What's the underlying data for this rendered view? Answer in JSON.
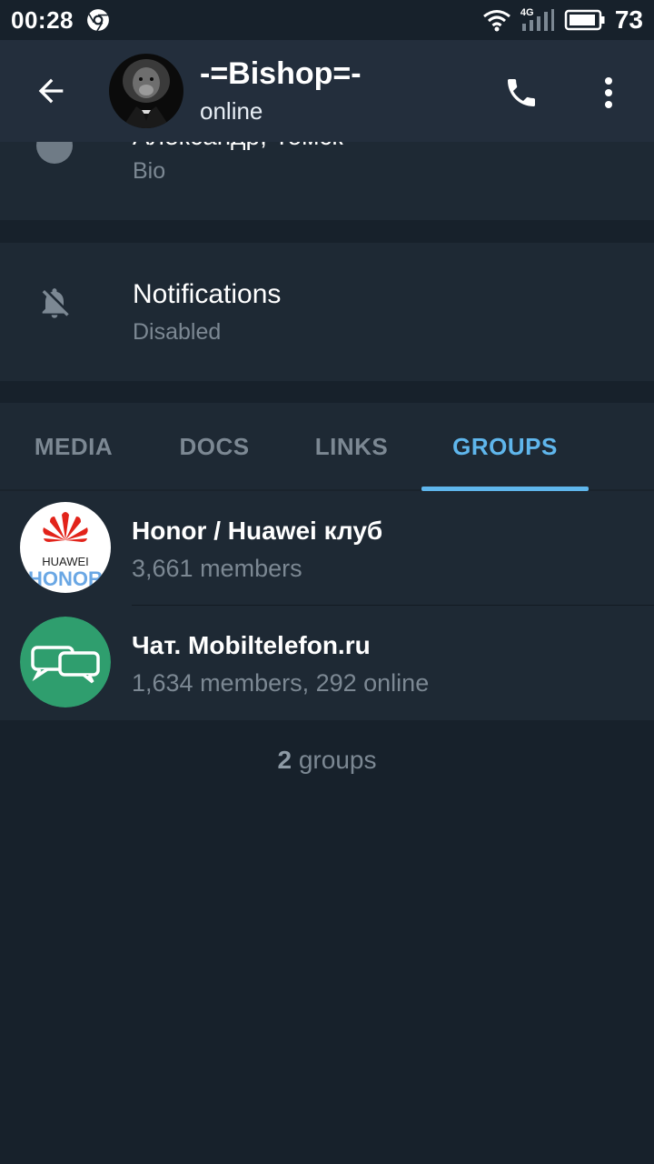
{
  "status_bar": {
    "time": "00:28",
    "network": "4G",
    "battery": "73"
  },
  "header": {
    "title": "-=Bishop=-",
    "status": "online"
  },
  "bio": {
    "value": "Александр, Томск",
    "label": "Bio"
  },
  "notifications": {
    "title": "Notifications",
    "value": "Disabled"
  },
  "tabs": [
    {
      "label": "MEDIA",
      "active": false
    },
    {
      "label": "DOCS",
      "active": false
    },
    {
      "label": "LINKS",
      "active": false
    },
    {
      "label": "GROUPS",
      "active": true
    }
  ],
  "groups": [
    {
      "name": "Honor / Huawei клуб",
      "meta": "3,661 members",
      "avatar": {
        "brand_top": "HUAWEI",
        "brand_bottom": "HONOR"
      }
    },
    {
      "name": "Чат. Mobiltelefon.ru",
      "meta": "1,634 members, 292 online"
    }
  ],
  "footer": {
    "count": "2",
    "label": "groups"
  },
  "colors": {
    "accent": "#5fb6ec",
    "background": "#17212b",
    "surface": "#1e2934",
    "header": "#232e3c",
    "muted_text": "#7c8893",
    "chat_group_avatar": "#2f9e6e"
  },
  "icons": {
    "back": "arrow-left-icon",
    "call": "phone-icon",
    "more": "more-vertical-icon",
    "notifications": "bell-off-icon",
    "bio": "info-icon"
  }
}
